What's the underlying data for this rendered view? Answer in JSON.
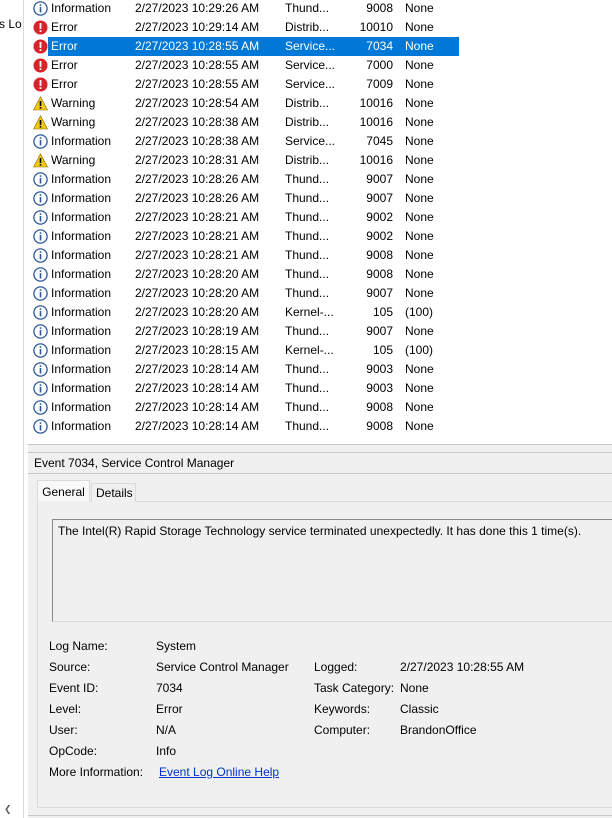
{
  "left_panel": {
    "cut_label": "s Lo"
  },
  "events": [
    {
      "level": "Information",
      "icon": "info-icon",
      "date": "2/27/2023 10:29:26 AM",
      "source": "Thund...",
      "event_id": "9008",
      "category": "None"
    },
    {
      "level": "Error",
      "icon": "error-icon",
      "date": "2/27/2023 10:29:14 AM",
      "source": "Distrib...",
      "event_id": "10010",
      "category": "None"
    },
    {
      "level": "Error",
      "icon": "error-icon",
      "date": "2/27/2023 10:28:55 AM",
      "source": "Service...",
      "event_id": "7034",
      "category": "None",
      "selected": true
    },
    {
      "level": "Error",
      "icon": "error-icon",
      "date": "2/27/2023 10:28:55 AM",
      "source": "Service...",
      "event_id": "7000",
      "category": "None"
    },
    {
      "level": "Error",
      "icon": "error-icon",
      "date": "2/27/2023 10:28:55 AM",
      "source": "Service...",
      "event_id": "7009",
      "category": "None"
    },
    {
      "level": "Warning",
      "icon": "warning-icon",
      "date": "2/27/2023 10:28:54 AM",
      "source": "Distrib...",
      "event_id": "10016",
      "category": "None"
    },
    {
      "level": "Warning",
      "icon": "warning-icon",
      "date": "2/27/2023 10:28:38 AM",
      "source": "Distrib...",
      "event_id": "10016",
      "category": "None"
    },
    {
      "level": "Information",
      "icon": "info-icon",
      "date": "2/27/2023 10:28:38 AM",
      "source": "Service...",
      "event_id": "7045",
      "category": "None"
    },
    {
      "level": "Warning",
      "icon": "warning-icon",
      "date": "2/27/2023 10:28:31 AM",
      "source": "Distrib...",
      "event_id": "10016",
      "category": "None"
    },
    {
      "level": "Information",
      "icon": "info-icon",
      "date": "2/27/2023 10:28:26 AM",
      "source": "Thund...",
      "event_id": "9007",
      "category": "None"
    },
    {
      "level": "Information",
      "icon": "info-icon",
      "date": "2/27/2023 10:28:26 AM",
      "source": "Thund...",
      "event_id": "9007",
      "category": "None"
    },
    {
      "level": "Information",
      "icon": "info-icon",
      "date": "2/27/2023 10:28:21 AM",
      "source": "Thund...",
      "event_id": "9002",
      "category": "None"
    },
    {
      "level": "Information",
      "icon": "info-icon",
      "date": "2/27/2023 10:28:21 AM",
      "source": "Thund...",
      "event_id": "9002",
      "category": "None"
    },
    {
      "level": "Information",
      "icon": "info-icon",
      "date": "2/27/2023 10:28:21 AM",
      "source": "Thund...",
      "event_id": "9008",
      "category": "None"
    },
    {
      "level": "Information",
      "icon": "info-icon",
      "date": "2/27/2023 10:28:20 AM",
      "source": "Thund...",
      "event_id": "9008",
      "category": "None"
    },
    {
      "level": "Information",
      "icon": "info-icon",
      "date": "2/27/2023 10:28:20 AM",
      "source": "Thund...",
      "event_id": "9007",
      "category": "None"
    },
    {
      "level": "Information",
      "icon": "info-icon",
      "date": "2/27/2023 10:28:20 AM",
      "source": "Kernel-...",
      "event_id": "105",
      "category": "(100)"
    },
    {
      "level": "Information",
      "icon": "info-icon",
      "date": "2/27/2023 10:28:19 AM",
      "source": "Thund...",
      "event_id": "9007",
      "category": "None"
    },
    {
      "level": "Information",
      "icon": "info-icon",
      "date": "2/27/2023 10:28:15 AM",
      "source": "Kernel-...",
      "event_id": "105",
      "category": "(100)"
    },
    {
      "level": "Information",
      "icon": "info-icon",
      "date": "2/27/2023 10:28:14 AM",
      "source": "Thund...",
      "event_id": "9003",
      "category": "None"
    },
    {
      "level": "Information",
      "icon": "info-icon",
      "date": "2/27/2023 10:28:14 AM",
      "source": "Thund...",
      "event_id": "9003",
      "category": "None"
    },
    {
      "level": "Information",
      "icon": "info-icon",
      "date": "2/27/2023 10:28:14 AM",
      "source": "Thund...",
      "event_id": "9008",
      "category": "None"
    },
    {
      "level": "Information",
      "icon": "info-icon",
      "date": "2/27/2023 10:28:14 AM",
      "source": "Thund...",
      "event_id": "9008",
      "category": "None"
    }
  ],
  "details": {
    "title": "Event 7034, Service Control Manager",
    "tabs": {
      "general": "General",
      "details": "Details"
    },
    "message": "The Intel(R) Rapid Storage Technology service terminated unexpectedly.  It has done this 1 time(s).",
    "labels": {
      "log_name": "Log Name:",
      "source": "Source:",
      "event_id": "Event ID:",
      "level": "Level:",
      "user": "User:",
      "opcode": "OpCode:",
      "more_info": "More Information:",
      "logged": "Logged:",
      "task_category": "Task Category:",
      "keywords": "Keywords:",
      "computer": "Computer:"
    },
    "values": {
      "log_name": "System",
      "source": "Service Control Manager",
      "event_id": "7034",
      "level": "Error",
      "user": "N/A",
      "opcode": "Info",
      "more_info_link": "Event Log Online Help",
      "logged": "2/27/2023 10:28:55 AM",
      "task_category": "None",
      "keywords": "Classic",
      "computer": "BrandonOffice"
    }
  },
  "colors": {
    "selection": "#0078d7",
    "link": "#0033cc",
    "error": "#d8232a",
    "warning": "#f2c811",
    "info": "#2b579a"
  }
}
